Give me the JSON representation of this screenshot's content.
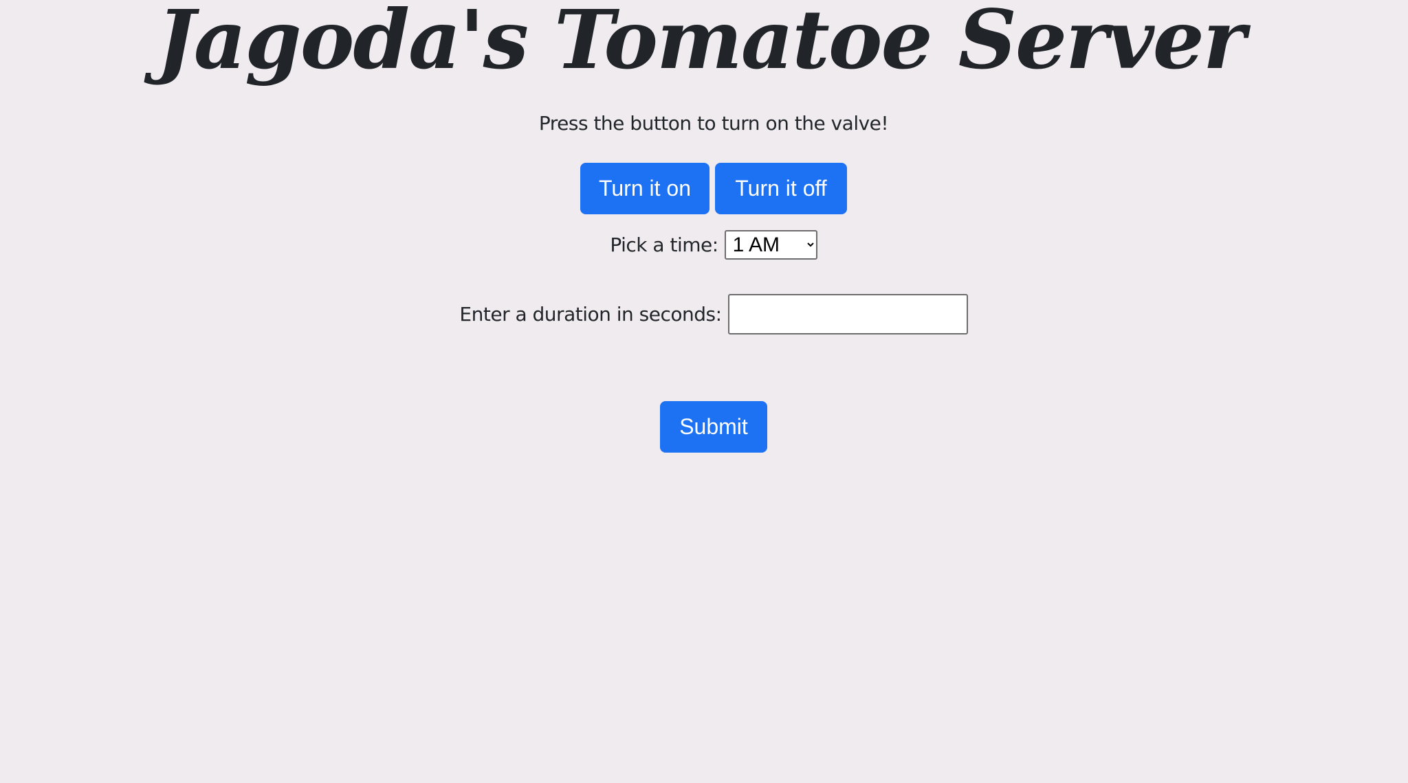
{
  "header": {
    "title": "Jagoda's Tomatoe Server",
    "subtitle": "Press the button to turn on the valve!"
  },
  "controls": {
    "turn_on_label": "Turn it on",
    "turn_off_label": "Turn it off"
  },
  "schedule": {
    "time_label": "Pick a time:",
    "time_selected": "1 AM",
    "duration_label": "Enter a duration in seconds:",
    "duration_value": ""
  },
  "form": {
    "submit_label": "Submit"
  },
  "colors": {
    "background": "#efebef",
    "button": "#1d72f4",
    "text": "#212529"
  }
}
